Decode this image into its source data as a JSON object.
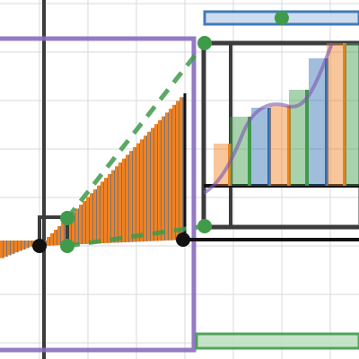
{
  "graph": {
    "colors": {
      "purple": "#8a6cc0",
      "orange": "#f0811f",
      "blue": "#2e6db2",
      "green": "#3f9b4a",
      "black": "#111111",
      "dark_gray": "#3c3c3c",
      "grid": "#d9d9d9"
    },
    "slider_blue": {
      "value": 0.47
    },
    "slider_green": {
      "value": 0.0
    }
  }
}
